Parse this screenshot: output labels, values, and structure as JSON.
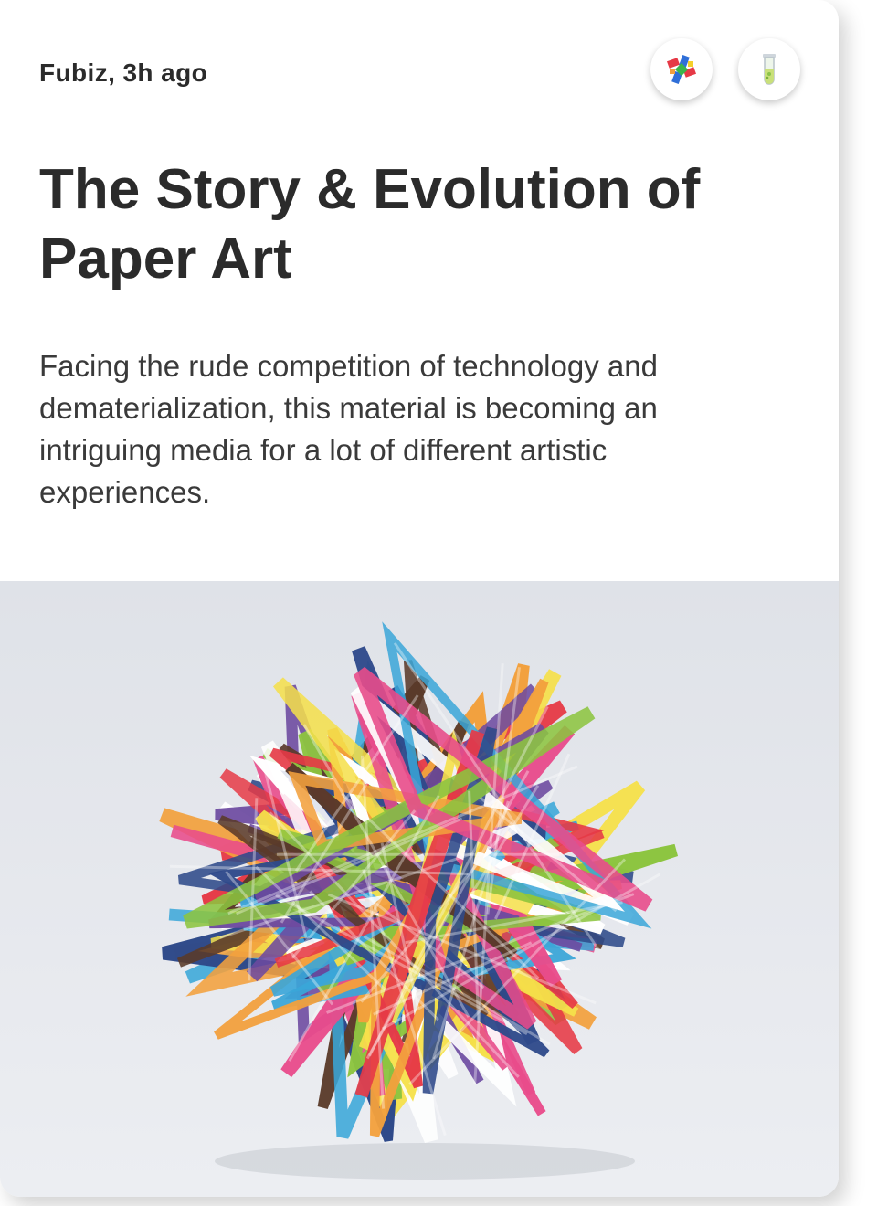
{
  "article": {
    "meta": "Fubiz, 3h ago",
    "title": "The Story & Evolution of Paper Art",
    "description": "Facing the rude competition of technology and dematerialization, this material is becoming an intriguing media for a lot of different artistic experiences."
  },
  "actions": [
    {
      "icon": "colorful-logo-icon"
    },
    {
      "icon": "test-tube-icon"
    }
  ],
  "image": {
    "subject": "paper-polyhedron-sculpture",
    "colors": [
      "#e63946",
      "#2f4a8a",
      "#f2a03d",
      "#8cc43f",
      "#e84c8b",
      "#6d4aa0",
      "#ffffff",
      "#5a3a2a",
      "#3aa6d8",
      "#f5e04a"
    ]
  }
}
